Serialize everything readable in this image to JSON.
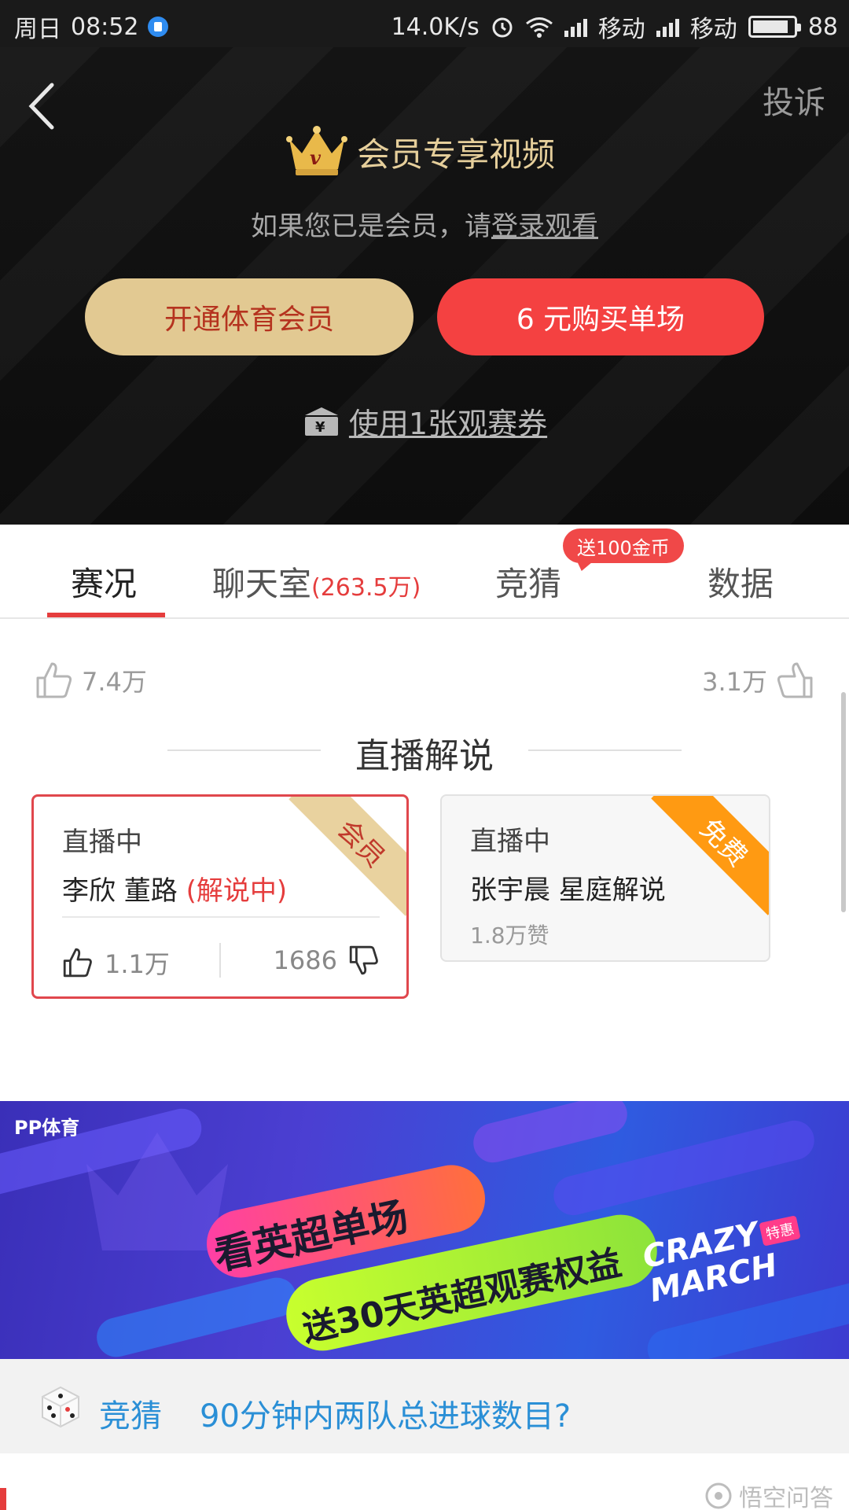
{
  "status_bar": {
    "day": "周日",
    "time": "08:52",
    "speed": "14.0K/s",
    "carrier1": "移动",
    "carrier2": "移动",
    "battery": "88"
  },
  "header": {
    "complain_label": "投诉",
    "vip_title": "会员专享视频",
    "hint_prefix": "如果您已是会员，请",
    "hint_login": "登录观看",
    "member_button": "开通体育会员",
    "buy_button": "6 元购买单场",
    "voucher_label": "使用1张观赛券"
  },
  "tabs": [
    {
      "label": "赛况",
      "active": true
    },
    {
      "label": "聊天室",
      "count": "(263.5万)"
    },
    {
      "label": "竞猜"
    },
    {
      "label": "数据"
    }
  ],
  "tab_badge": "送100金币",
  "likes": {
    "left": "7.4万",
    "right": "3.1万"
  },
  "section_title": "直播解说",
  "cards": [
    {
      "status": "直播中",
      "names": "李欣 董路 ",
      "live_tag": "(解说中)",
      "ribbon": "会员",
      "up": "1.1万",
      "down": "1686"
    },
    {
      "status": "直播中",
      "names": "张宇晨 星庭解说",
      "ribbon": "免费",
      "sub": "1.8万赞"
    }
  ],
  "banner": {
    "brand": "PP体育",
    "line1": "看英超单场",
    "line2": "送30天英超观赛权益",
    "crazy": "CRAZY MARCH",
    "tag": "特惠"
  },
  "quiz": {
    "label": "竞猜",
    "question": "90分钟内两队总进球数目?"
  },
  "watermark": "悟空问答",
  "colors": {
    "accent_red": "#e53d3d",
    "gold": "#e2c992",
    "quiz_blue": "#2a8fd6"
  }
}
